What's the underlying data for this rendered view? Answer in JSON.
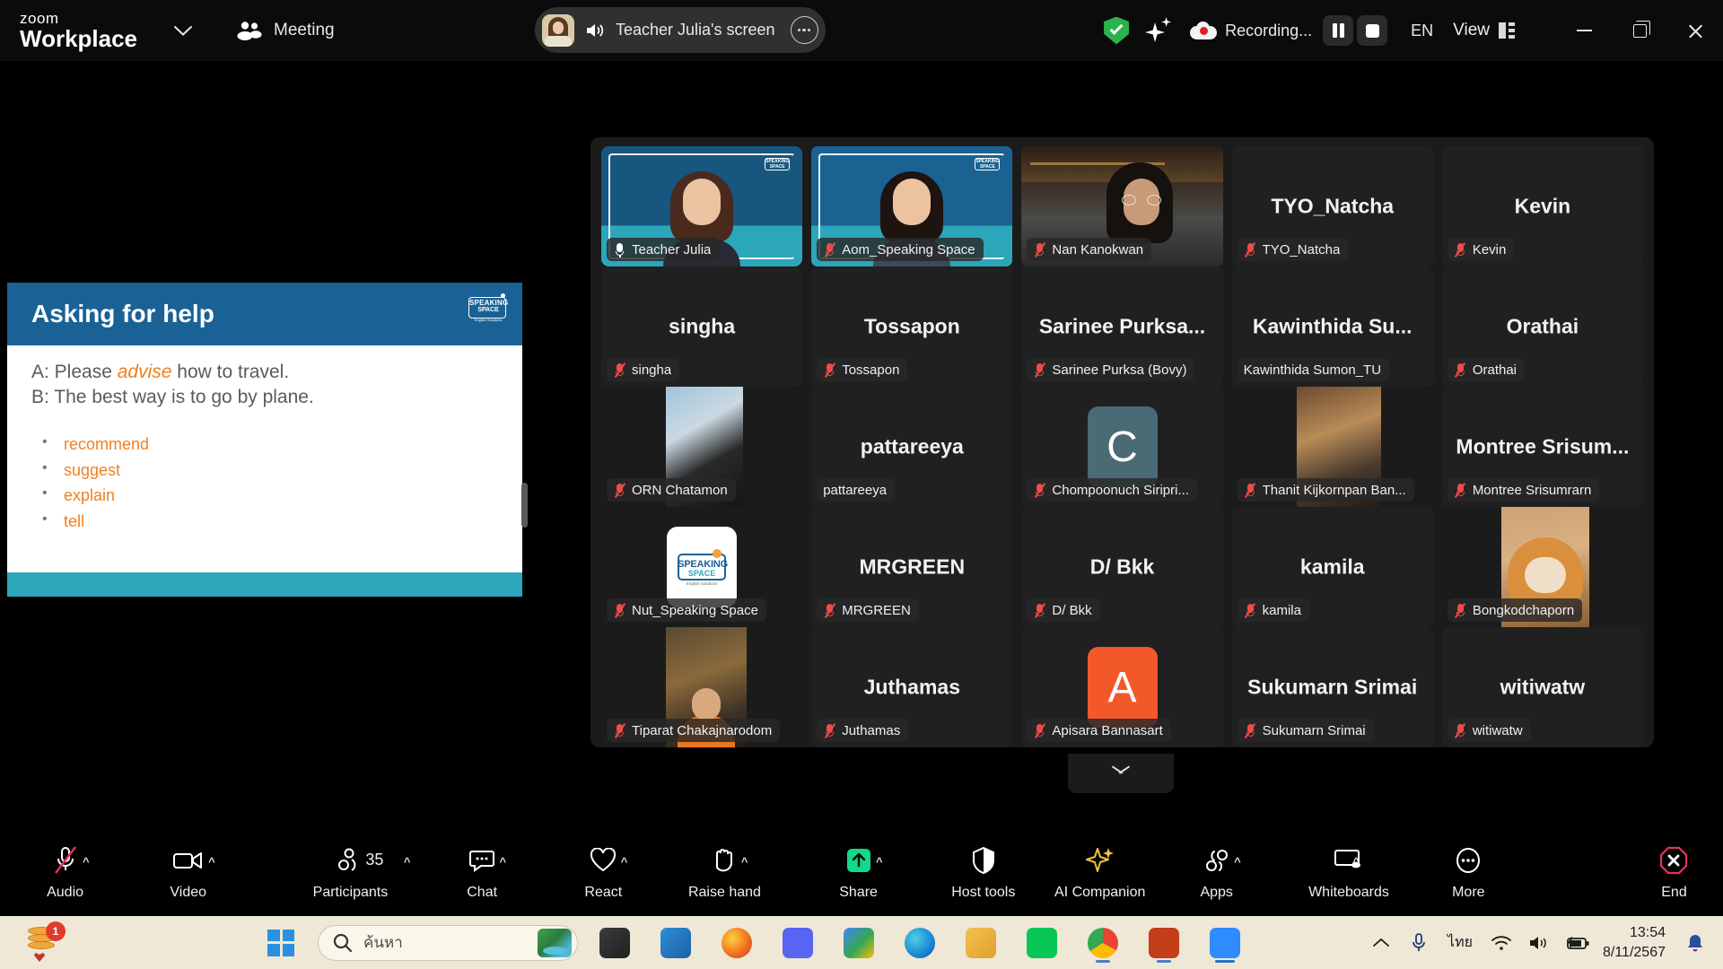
{
  "titlebar": {
    "brand_line1": "zoom",
    "brand_line2": "Workplace",
    "meeting_label": "Meeting",
    "share_label": "Teacher Julia's screen",
    "recording_label": "Recording...",
    "language": "EN",
    "view_label": "View",
    "minimize": "Minimize",
    "maximize": "Restore",
    "close": "Close"
  },
  "slide": {
    "title": "Asking for help",
    "line_a_prefix": "A: Please ",
    "line_a_em": "advise",
    "line_a_suffix": " how to travel.",
    "line_b": "B: The best way is to go by plane.",
    "bullets": [
      "recommend",
      "suggest",
      "explain",
      "tell"
    ],
    "logo_line1": "SPEAKING",
    "logo_line2": "SPACE",
    "logo_line3": "English Solutions",
    "header_color": "#1a6296",
    "accent_color": "#ef8023",
    "footer_color": "#2ba6bb"
  },
  "grid": {
    "rows": [
      [
        {
          "name": "Teacher Julia",
          "big": "",
          "muted": false,
          "active": true,
          "video": "julia"
        },
        {
          "name": "Aom_Speaking Space",
          "big": "",
          "muted": true,
          "active": false,
          "video": "aom"
        },
        {
          "name": "Nan Kanokwan",
          "big": "",
          "muted": true,
          "active": false,
          "video": "nan"
        },
        {
          "name": "TYO_Natcha",
          "big": "TYO_Natcha",
          "muted": true,
          "active": false,
          "video": ""
        },
        {
          "name": "Kevin",
          "big": "Kevin",
          "muted": true,
          "active": false,
          "video": ""
        }
      ],
      [
        {
          "name": "singha",
          "big": "singha",
          "muted": true,
          "active": false,
          "video": ""
        },
        {
          "name": "Tossapon",
          "big": "Tossapon",
          "muted": true,
          "active": false,
          "video": ""
        },
        {
          "name": "Sarinee Purksa (Bovy)",
          "big": "Sarinee  Purksa...",
          "muted": true,
          "active": false,
          "video": ""
        },
        {
          "name": "Kawinthida Sumon_TU",
          "big": "Kawinthida  Su...",
          "muted": false,
          "active": false,
          "video": ""
        },
        {
          "name": "Orathai",
          "big": "Orathai",
          "muted": true,
          "active": false,
          "video": ""
        }
      ],
      [
        {
          "name": "ORN Chatamon",
          "big": "",
          "muted": true,
          "active": false,
          "video": "orn"
        },
        {
          "name": "pattareeya",
          "big": "pattareeya",
          "muted": false,
          "active": false,
          "video": "",
          "underline": true
        },
        {
          "name": "Chompoonuch Siripri...",
          "big": "",
          "muted": true,
          "active": false,
          "video": "avatar-c",
          "avatar_letter": "C",
          "avatar_color": "#4a6a76"
        },
        {
          "name": "Thanit Kijkornpan Ban...",
          "big": "",
          "muted": true,
          "active": false,
          "video": "thanit"
        },
        {
          "name": "Montree Srisumrarn",
          "big": "Montree  Srisum...",
          "muted": true,
          "active": false,
          "video": ""
        }
      ],
      [
        {
          "name": "Nut_Speaking Space",
          "big": "",
          "muted": true,
          "active": false,
          "video": "ss-logo"
        },
        {
          "name": "MRGREEN",
          "big": "MRGREEN",
          "muted": true,
          "active": false,
          "video": ""
        },
        {
          "name": "D/ Bkk",
          "big": "D/ Bkk",
          "muted": true,
          "active": false,
          "video": ""
        },
        {
          "name": "kamila",
          "big": "kamila",
          "muted": true,
          "active": false,
          "video": ""
        },
        {
          "name": "Bongkodchaporn",
          "big": "",
          "muted": true,
          "active": false,
          "video": "dog"
        }
      ],
      [
        {
          "name": "Tiparat Chakajnarodom",
          "big": "",
          "muted": true,
          "active": false,
          "video": "tiparat"
        },
        {
          "name": "Juthamas",
          "big": "Juthamas",
          "muted": true,
          "active": false,
          "video": ""
        },
        {
          "name": "Apisara Bannasart",
          "big": "",
          "muted": true,
          "active": false,
          "video": "avatar-a",
          "avatar_letter": "A",
          "avatar_color": "#f3582a"
        },
        {
          "name": "Sukumarn Srimai",
          "big": "Sukumarn Srimai",
          "muted": true,
          "active": false,
          "video": ""
        },
        {
          "name": "witiwatw",
          "big": "witiwatw",
          "muted": true,
          "active": false,
          "video": ""
        }
      ]
    ]
  },
  "toolbar": {
    "items": [
      {
        "label": "Audio",
        "icon": "microphone-muted-icon",
        "caret": true,
        "count": null
      },
      {
        "label": "Video",
        "icon": "camera-icon",
        "caret": true,
        "count": null
      },
      {
        "label": "Participants",
        "icon": "participants-icon",
        "caret": true,
        "count": "35"
      },
      {
        "label": "Chat",
        "icon": "chat-icon",
        "caret": true,
        "count": null
      },
      {
        "label": "React",
        "icon": "heart-icon",
        "caret": true,
        "count": null
      },
      {
        "label": "Raise hand",
        "icon": "hand-icon",
        "caret": true,
        "count": null
      },
      {
        "label": "Share",
        "icon": "share-screen-icon",
        "caret": true,
        "count": null
      },
      {
        "label": "Host tools",
        "icon": "shield-icon",
        "caret": false,
        "count": null
      },
      {
        "label": "AI Companion",
        "icon": "sparkle-icon",
        "caret": false,
        "count": null
      },
      {
        "label": "Apps",
        "icon": "apps-icon",
        "caret": true,
        "count": null
      },
      {
        "label": "Whiteboards",
        "icon": "whiteboard-icon",
        "caret": true,
        "count": null
      },
      {
        "label": "More",
        "icon": "ellipsis-icon",
        "caret": false,
        "count": null
      },
      {
        "label": "End",
        "icon": "end-call-icon",
        "caret": false,
        "count": null
      }
    ]
  },
  "taskbar": {
    "badge_count": "1",
    "search_placeholder": "ค้นหา",
    "language": "ไทย",
    "time": "13:54",
    "date": "8/11/2567"
  }
}
